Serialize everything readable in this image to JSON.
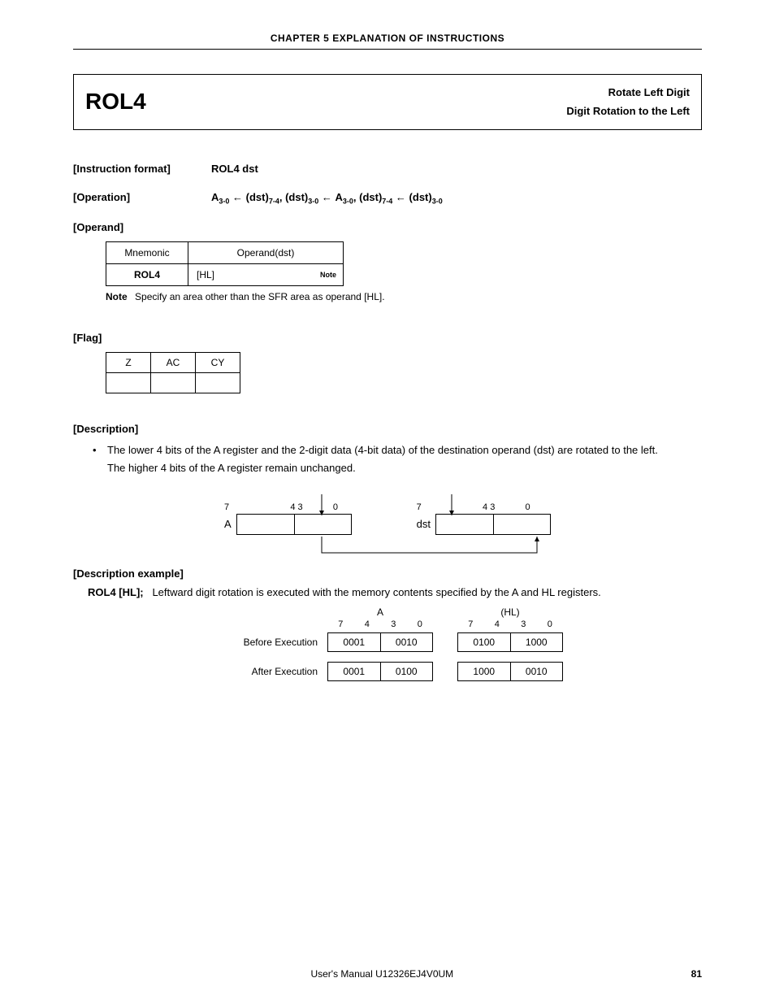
{
  "chapter_header": "CHAPTER 5  EXPLANATION OF INSTRUCTIONS",
  "title": {
    "mnemonic": "ROL4",
    "line1": "Rotate Left Digit",
    "line2": "Digit Rotation to the Left"
  },
  "format": {
    "label": "[Instruction format]",
    "value": "ROL4 dst"
  },
  "operation": {
    "label": "[Operation]",
    "parts": {
      "A": "A",
      "s30": "3-0",
      "arr": " ← ",
      "dst": "(dst)",
      "s74": "7-4",
      "c": ", "
    }
  },
  "operand": {
    "label": "[Operand]",
    "headers": {
      "mnemonic": "Mnemonic",
      "operand": "Operand(dst)"
    },
    "row": {
      "mnemonic": "ROL4",
      "operand": "[HL]",
      "note_badge": "Note"
    },
    "note_label": "Note",
    "note_text": "Specify an area other than the SFR area as operand [HL]."
  },
  "flag": {
    "label": "[Flag]",
    "headers": {
      "z": "Z",
      "ac": "AC",
      "cy": "CY"
    }
  },
  "description": {
    "label": "[Description]",
    "bullet1": "The lower 4 bits of the A register and the 2-digit data (4-bit data) of the destination operand (dst) are rotated to the left.",
    "line2": "The higher 4 bits of the A register remain unchanged."
  },
  "diagram": {
    "A_label": "A",
    "dst_label": "dst",
    "bits": {
      "b7": "7",
      "b4": "4",
      "b3": "3",
      "b0": "0"
    }
  },
  "example": {
    "label": "[Description example]",
    "code": "ROL4 [HL];",
    "text": "Leftward digit rotation is executed with the memory contents specified by the A and HL registers.",
    "col_A": "A",
    "col_HL": "(HL)",
    "bits": {
      "b7": "7",
      "b4": "4",
      "b3": "3",
      "b0": "0"
    },
    "rows": [
      {
        "label": "Before Execution",
        "A_hi": "0001",
        "A_lo": "0010",
        "HL_hi": "0100",
        "HL_lo": "1000"
      },
      {
        "label": "After Execution",
        "A_hi": "0001",
        "A_lo": "0100",
        "HL_hi": "1000",
        "HL_lo": "0010"
      }
    ]
  },
  "footer": {
    "manual": "User's Manual  U12326EJ4V0UM",
    "page": "81"
  }
}
